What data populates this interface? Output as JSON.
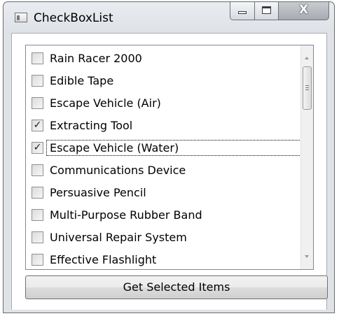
{
  "window": {
    "title": "CheckBoxList",
    "icon": "window-app-icon"
  },
  "caption_buttons": {
    "minimize_icon": "minimize-icon",
    "maximize_icon": "maximize-icon",
    "close_glyph": "X"
  },
  "list": {
    "items": [
      {
        "label": "Rain Racer 2000",
        "checked": false,
        "check_glyph": ""
      },
      {
        "label": "Edible Tape",
        "checked": false,
        "check_glyph": ""
      },
      {
        "label": "Escape Vehicle (Air)",
        "checked": false,
        "check_glyph": ""
      },
      {
        "label": "Extracting Tool",
        "checked": true,
        "check_glyph": "✓"
      },
      {
        "label": "Escape Vehicle (Water)",
        "checked": true,
        "check_glyph": "✓",
        "focused": true
      },
      {
        "label": "Communications Device",
        "checked": false,
        "check_glyph": ""
      },
      {
        "label": "Persuasive Pencil",
        "checked": false,
        "check_glyph": ""
      },
      {
        "label": "Multi-Purpose Rubber Band",
        "checked": false,
        "check_glyph": ""
      },
      {
        "label": "Universal Repair System",
        "checked": false,
        "check_glyph": ""
      },
      {
        "label": "Effective Flashlight",
        "checked": false,
        "check_glyph": ""
      }
    ]
  },
  "button": {
    "label": "Get Selected Items"
  }
}
